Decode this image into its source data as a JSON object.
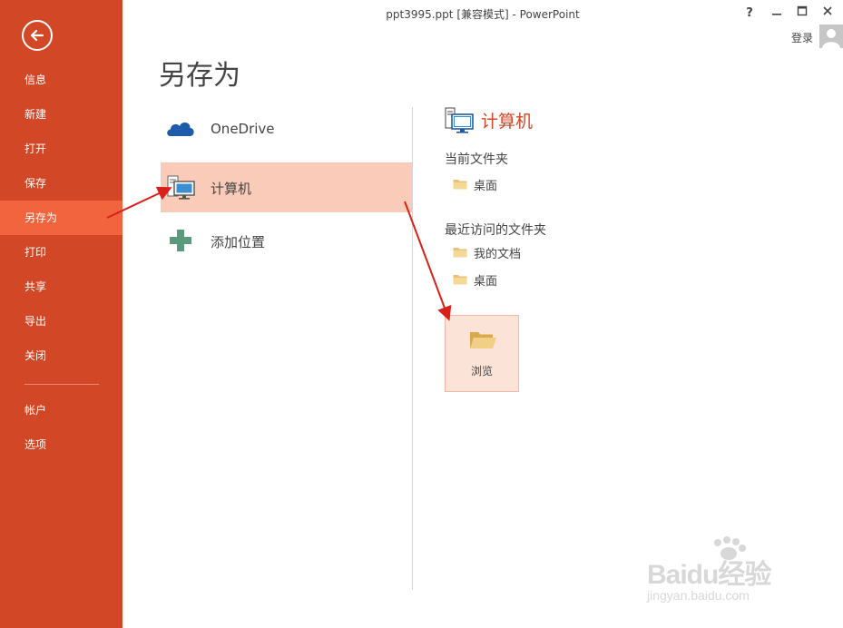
{
  "window": {
    "title": "ppt3995.ppt [兼容模式] - PowerPoint",
    "help": "?",
    "sign_in": "登录"
  },
  "sidebar": {
    "items": [
      {
        "label": "信息"
      },
      {
        "label": "新建"
      },
      {
        "label": "打开"
      },
      {
        "label": "保存"
      },
      {
        "label": "另存为",
        "active": true
      },
      {
        "label": "打印"
      },
      {
        "label": "共享"
      },
      {
        "label": "导出"
      },
      {
        "label": "关闭"
      },
      {
        "label": "帐户"
      },
      {
        "label": "选项"
      }
    ]
  },
  "page": {
    "title": "另存为"
  },
  "locations": [
    {
      "label": "OneDrive",
      "icon": "cloud-icon"
    },
    {
      "label": "计算机",
      "icon": "computer-icon",
      "selected": true
    },
    {
      "label": "添加位置",
      "icon": "plus-icon"
    }
  ],
  "computer_panel": {
    "title": "计算机",
    "current_folder_title": "当前文件夹",
    "current_folders": [
      {
        "label": "桌面"
      }
    ],
    "recent_folder_title": "最近访问的文件夹",
    "recent_folders": [
      {
        "label": "我的文档"
      },
      {
        "label": "桌面"
      }
    ],
    "browse_label": "浏览"
  },
  "watermark": {
    "brand": "Baidu经验",
    "url": "jingyan.baidu.com"
  },
  "colors": {
    "sidebar": "#d24726",
    "sidebar_active": "#f1643d",
    "selected_location": "#f9cbb8",
    "accent_text": "#d24726",
    "annotation_arrow": "#d9211a"
  }
}
